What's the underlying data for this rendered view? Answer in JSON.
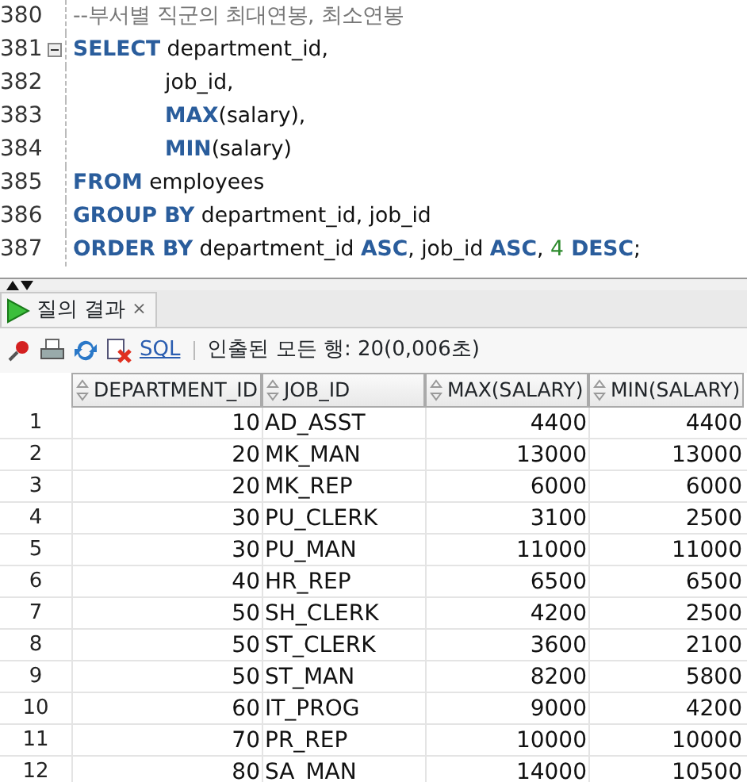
{
  "editor": {
    "lines": [
      {
        "number": "380",
        "fold": false,
        "indented": false,
        "tokens": [
          {
            "kind": "comment",
            "text": "--부서별 직군의 최대연봉, 최소연봉"
          }
        ]
      },
      {
        "number": "381",
        "fold": true,
        "indented": false,
        "tokens": [
          {
            "kind": "keyword",
            "text": "SELECT"
          },
          {
            "kind": "plain",
            "text": " department_id,"
          }
        ]
      },
      {
        "number": "382",
        "fold": false,
        "indented": true,
        "tokens": [
          {
            "kind": "plain",
            "text": "job_id,"
          }
        ]
      },
      {
        "number": "383",
        "fold": false,
        "indented": true,
        "tokens": [
          {
            "kind": "function",
            "text": "MAX"
          },
          {
            "kind": "plain",
            "text": "(salary),"
          }
        ]
      },
      {
        "number": "384",
        "fold": false,
        "indented": true,
        "tokens": [
          {
            "kind": "function",
            "text": "MIN"
          },
          {
            "kind": "plain",
            "text": "(salary)"
          }
        ]
      },
      {
        "number": "385",
        "fold": false,
        "indented": false,
        "tokens": [
          {
            "kind": "keyword",
            "text": "FROM"
          },
          {
            "kind": "plain",
            "text": " employees"
          }
        ]
      },
      {
        "number": "386",
        "fold": false,
        "indented": false,
        "tokens": [
          {
            "kind": "keyword",
            "text": "GROUP BY"
          },
          {
            "kind": "plain",
            "text": " department_id, job_id"
          }
        ]
      },
      {
        "number": "387",
        "fold": false,
        "indented": false,
        "tokens": [
          {
            "kind": "keyword",
            "text": "ORDER BY"
          },
          {
            "kind": "plain",
            "text": " department_id "
          },
          {
            "kind": "keyword",
            "text": "ASC"
          },
          {
            "kind": "plain",
            "text": ", job_id "
          },
          {
            "kind": "keyword",
            "text": "ASC"
          },
          {
            "kind": "plain",
            "text": ", "
          },
          {
            "kind": "number",
            "text": "4"
          },
          {
            "kind": "keyword",
            "text": " DESC"
          },
          {
            "kind": "plain",
            "text": ";"
          }
        ]
      }
    ]
  },
  "results_tab": {
    "label": "질의 결과",
    "close": "×"
  },
  "toolbar": {
    "sql_link": "SQL",
    "status": "인출된 모든 행: 20(0,006초)"
  },
  "table": {
    "columns": [
      "DEPARTMENT_ID",
      "JOB_ID",
      "MAX(SALARY)",
      "MIN(SALARY)"
    ],
    "rows": [
      {
        "row_number": "1",
        "cells": [
          "10",
          "AD_ASST",
          "4400",
          "4400"
        ]
      },
      {
        "row_number": "2",
        "cells": [
          "20",
          "MK_MAN",
          "13000",
          "13000"
        ]
      },
      {
        "row_number": "3",
        "cells": [
          "20",
          "MK_REP",
          "6000",
          "6000"
        ]
      },
      {
        "row_number": "4",
        "cells": [
          "30",
          "PU_CLERK",
          "3100",
          "2500"
        ]
      },
      {
        "row_number": "5",
        "cells": [
          "30",
          "PU_MAN",
          "11000",
          "11000"
        ]
      },
      {
        "row_number": "6",
        "cells": [
          "40",
          "HR_REP",
          "6500",
          "6500"
        ]
      },
      {
        "row_number": "7",
        "cells": [
          "50",
          "SH_CLERK",
          "4200",
          "2500"
        ]
      },
      {
        "row_number": "8",
        "cells": [
          "50",
          "ST_CLERK",
          "3600",
          "2100"
        ]
      },
      {
        "row_number": "9",
        "cells": [
          "50",
          "ST_MAN",
          "8200",
          "5800"
        ]
      },
      {
        "row_number": "10",
        "cells": [
          "60",
          "IT_PROG",
          "9000",
          "4200"
        ]
      },
      {
        "row_number": "11",
        "cells": [
          "70",
          "PR_REP",
          "10000",
          "10000"
        ]
      },
      {
        "row_number": "12",
        "cells": [
          "80",
          "SA_MAN",
          "14000",
          "10500"
        ]
      }
    ]
  }
}
